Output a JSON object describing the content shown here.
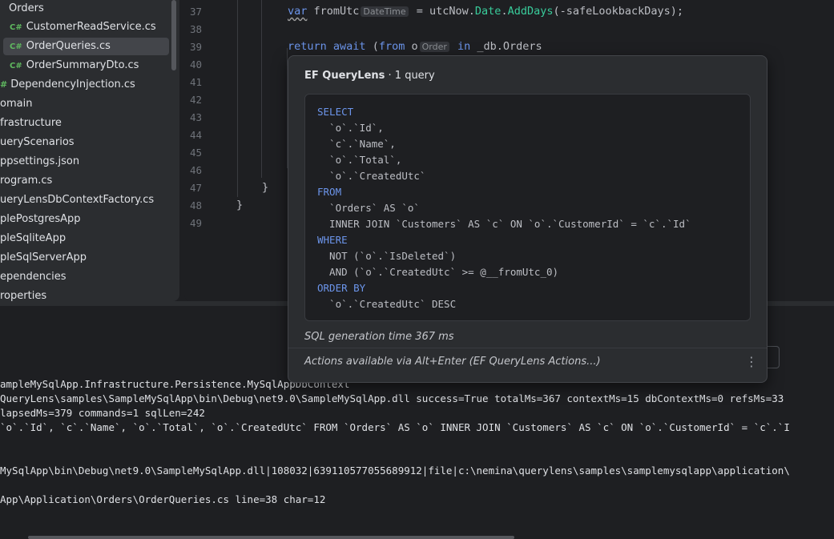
{
  "project_tree": {
    "items": [
      {
        "label": "Orders",
        "icon": "folder",
        "indent": "top"
      },
      {
        "label": "CustomerReadService.cs",
        "icon": "csharp-file"
      },
      {
        "label": "OrderQueries.cs",
        "icon": "csharp-file",
        "selected": true
      },
      {
        "label": "OrderSummaryDto.cs",
        "icon": "csharp-file"
      },
      {
        "label": "DependencyInjection.cs",
        "icon": "csharp-file"
      },
      {
        "label": "omain"
      },
      {
        "label": "frastructure"
      },
      {
        "label": "ueryScenarios"
      },
      {
        "label": "ppsettings.json"
      },
      {
        "label": "rogram.cs"
      },
      {
        "label": "ueryLensDbContextFactory.cs"
      },
      {
        "label": "plePostgresApp"
      },
      {
        "label": "pleSqliteApp"
      },
      {
        "label": "pleSqlServerApp"
      },
      {
        "label": "ependencies"
      },
      {
        "label": "roperties"
      }
    ],
    "csharp_badge": "C#",
    "hash_badge": "#"
  },
  "editor": {
    "line_numbers": [
      "37",
      "38",
      "39",
      "40",
      "41",
      "42",
      "43",
      "44",
      "45",
      "46",
      "47",
      "48",
      "49"
    ],
    "line37": {
      "var": "var",
      "ident": " fromUtc",
      "hint": "DateTime",
      "rest1": " = utcNow.",
      "m1": "Date",
      "dot": ".",
      "m2": "AddDays",
      "rest2": "(-safeLookbackDays);"
    },
    "line39": {
      "ret": "return",
      "await": " await",
      "p1": " (",
      "from": "from",
      "ident": " o",
      "hint": "Order",
      "in": " in",
      "rest": " _db.Orders"
    },
    "line47": "}",
    "line48": "}"
  },
  "popup": {
    "title_bold": "EF QueryLens",
    "title_rest": " · 1 query",
    "sql_lines": [
      {
        "kw": "SELECT",
        "text": ""
      },
      {
        "kw": "",
        "text": "  `o`.`Id`,"
      },
      {
        "kw": "",
        "text": "  `c`.`Name`,"
      },
      {
        "kw": "",
        "text": "  `o`.`Total`,"
      },
      {
        "kw": "",
        "text": "  `o`.`CreatedUtc`"
      },
      {
        "kw": "FROM",
        "text": ""
      },
      {
        "kw": "",
        "text": "  `Orders` AS `o`"
      },
      {
        "kw": "",
        "text": "  INNER JOIN `Customers` AS `c` ON `o`.`CustomerId` = `c`.`Id`"
      },
      {
        "kw": "WHERE",
        "text": ""
      },
      {
        "kw": "",
        "text": "  NOT (`o`.`IsDeleted`)"
      },
      {
        "kw": "",
        "text": "  AND (`o`.`CreatedUtc` >= @__fromUtc_0)"
      },
      {
        "kw": "ORDER BY",
        "text": ""
      },
      {
        "kw": "",
        "text": "  `o`.`CreatedUtc` DESC"
      }
    ],
    "generation_time": "SQL generation time 367 ms",
    "actions_hint": "Actions available via Alt+Enter (EF QueryLens Actions...)",
    "more_icon": "⋮"
  },
  "console": {
    "lines": [
      "ampleMySqlApp.Infrastructure.Persistence.MySqlAppDbContext",
      "QueryLens\\samples\\SampleMySqlApp\\bin\\Debug\\net9.0\\SampleMySqlApp.dll success=True totalMs=367 contextMs=15 dbContextMs=0 refsMs=33",
      "lapsedMs=379 commands=1 sqlLen=242",
      "`o`.`Id`, `c`.`Name`, `o`.`Total`, `o`.`CreatedUtc` FROM `Orders` AS `o` INNER JOIN `Customers` AS `c` ON `o`.`CustomerId` = `c`.`I",
      "",
      "MySqlApp\\bin\\Debug\\net9.0\\SampleMySqlApp.dll|108032|639110577055689912|file|c:\\nemina\\querylens\\samples\\samplemysqlapp\\application\\",
      "",
      "App\\Application\\Orders\\OrderQueries.cs line=38 char=12"
    ]
  },
  "colors": {
    "background": "#1e1f22",
    "panel": "#2b2d30",
    "keyword": "#6c95eb",
    "method": "#39cc9b",
    "csharp_icon": "#5fb85f"
  }
}
